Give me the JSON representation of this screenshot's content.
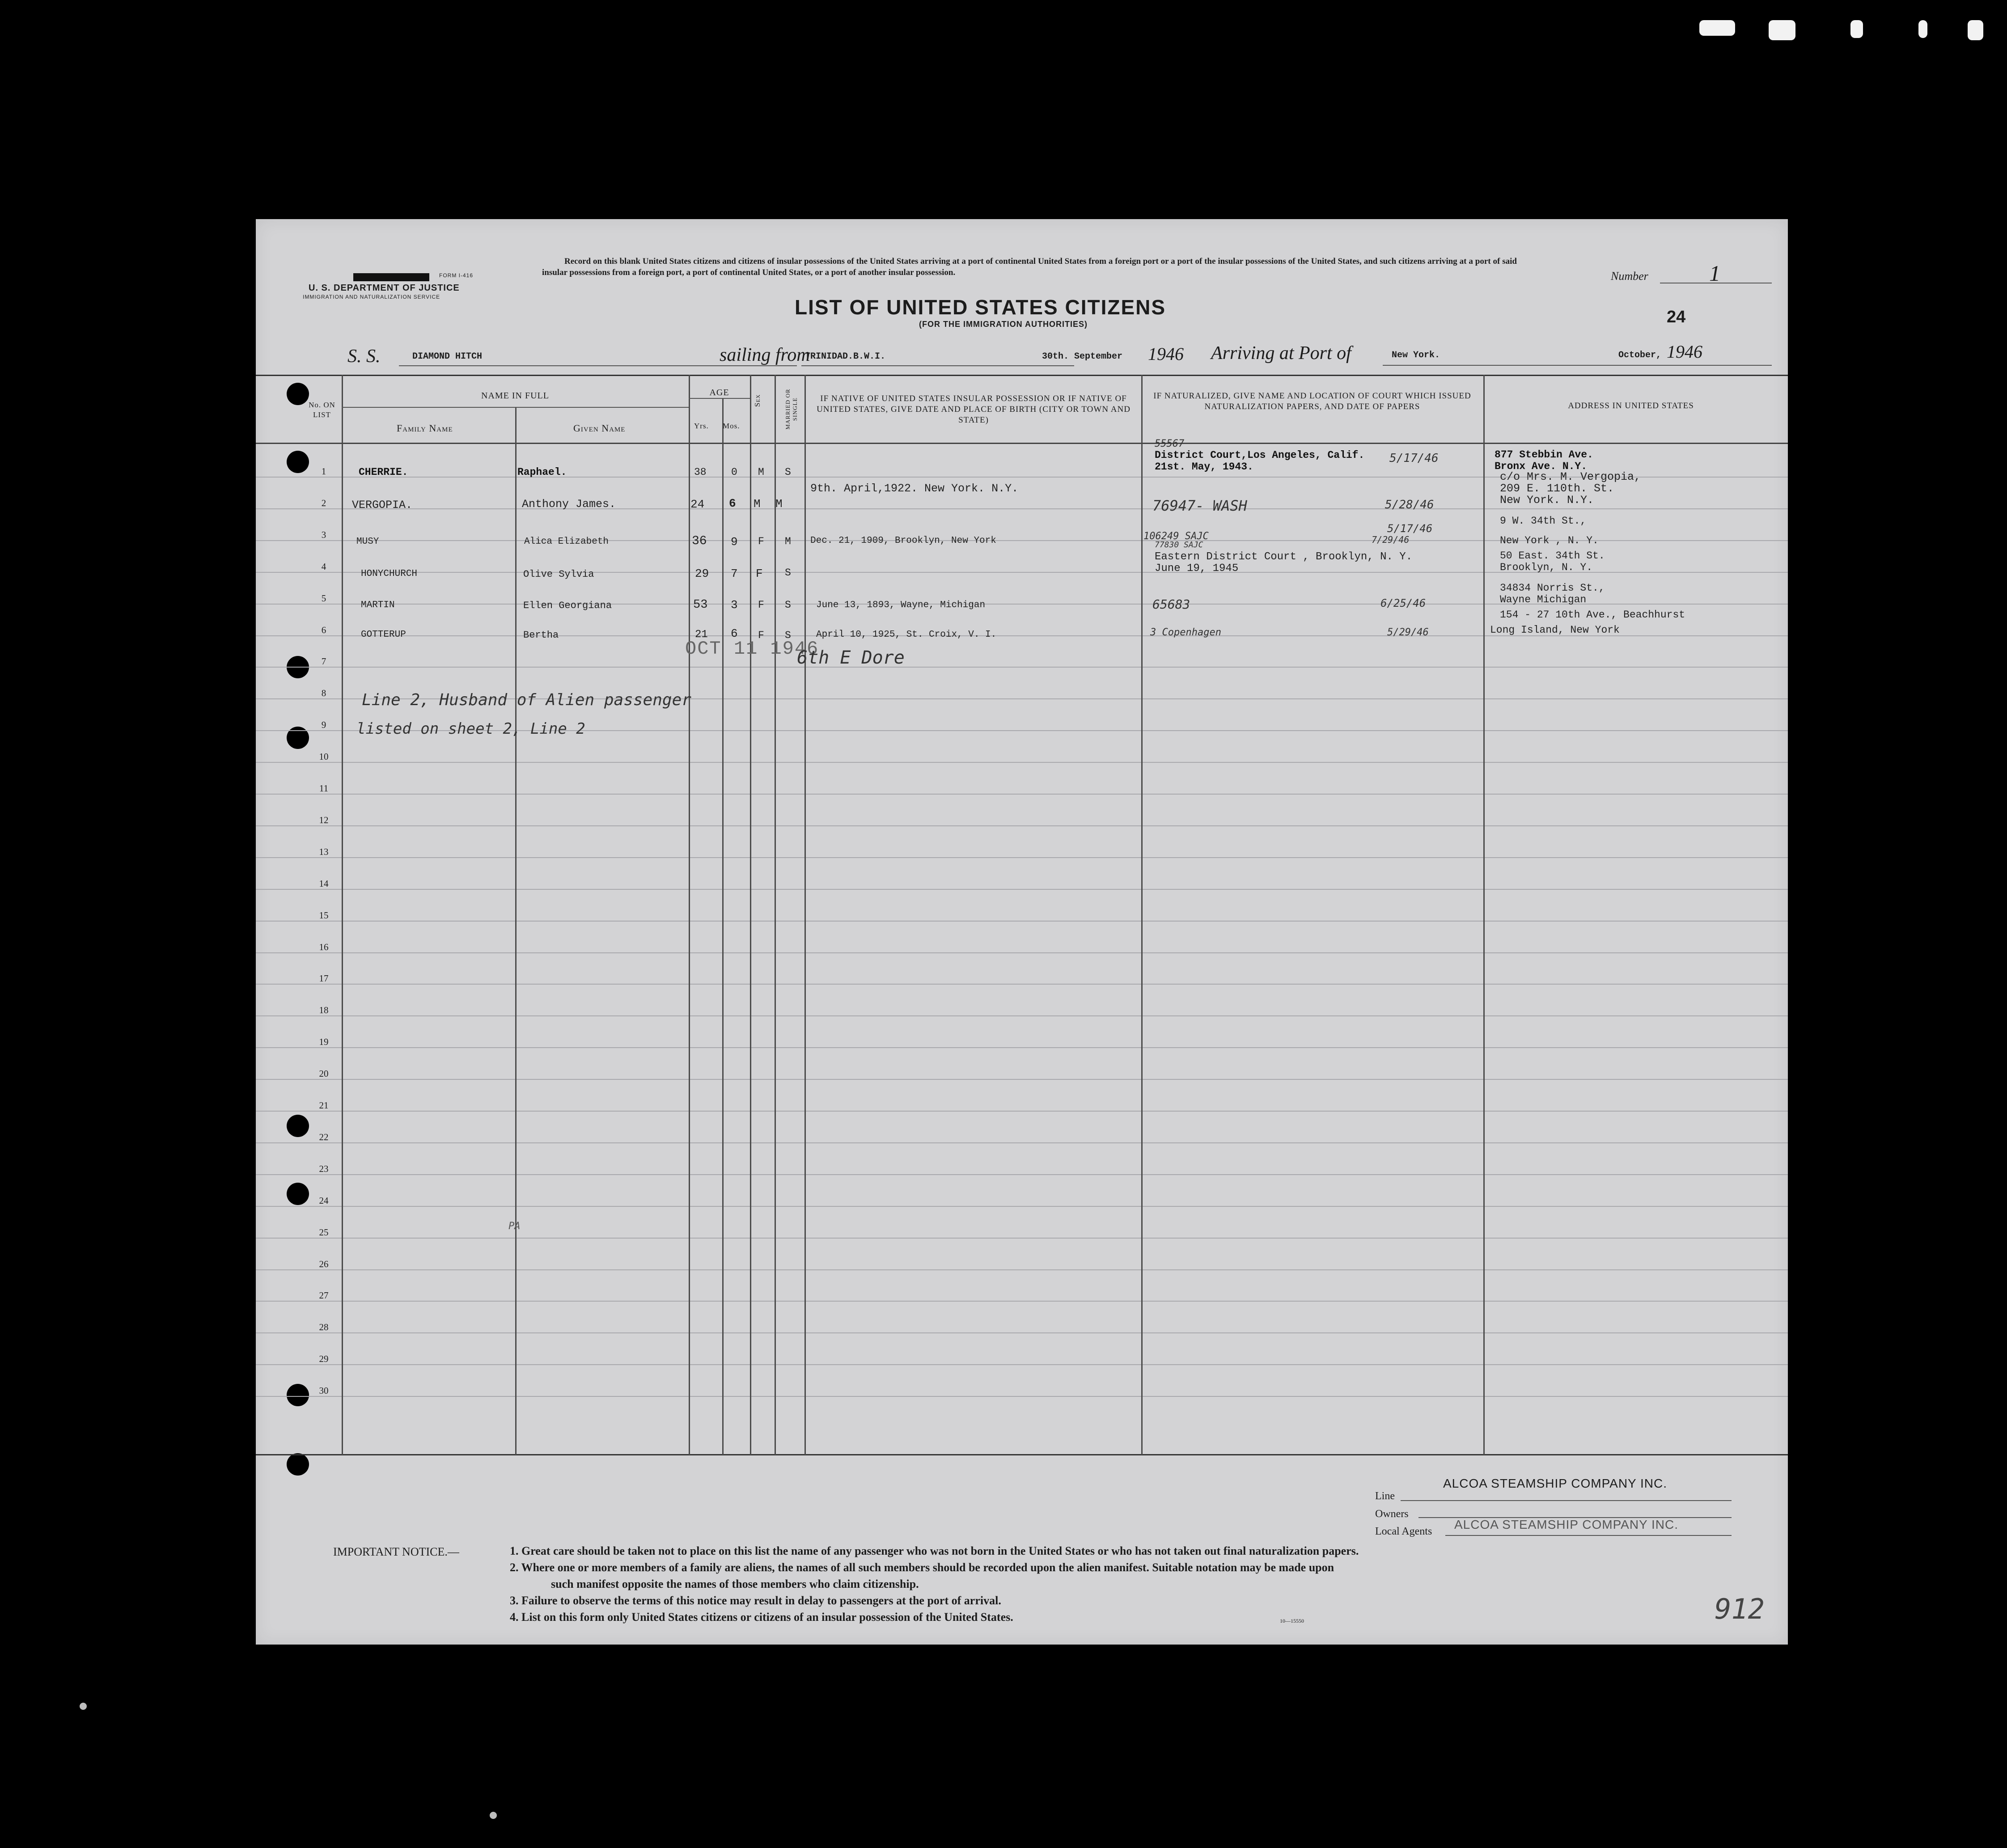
{
  "header": {
    "dept_line1": "U. S. DEPARTMENT OF JUSTICE",
    "dept_line2": "IMMIGRATION AND NATURALIZATION SERVICE",
    "form_number": "FORM I-416",
    "record_instructions": "Record on this blank United States citizens and citizens of insular possessions of the United States arriving at a port of continental United States from a foreign port or a port of the insular possessions of the United States, and such citizens arriving at a port of said insular possessions from a foreign port, a port of continental United States, or a port of another insular possession.",
    "number_label": "Number",
    "number_value": "1",
    "sheet_count": "24",
    "title": "LIST OF UNITED STATES CITIZENS",
    "subtitle": "(FOR THE IMMIGRATION AUTHORITIES)"
  },
  "voyage": {
    "ss_label": "S. S.",
    "ship": "DIAMOND HITCH",
    "sailing_label": "sailing from",
    "port_from": "TRINIDAD.B.W.I.",
    "sail_date": "30th. September",
    "sail_year": "1946",
    "arriving_label": "Arriving at Port of",
    "port_to": "New York.",
    "arrival_month": "October,",
    "arrival_year": "1946"
  },
  "columns": {
    "no_on_list": "No. ON LIST",
    "name_in_full": "NAME IN FULL",
    "family_name": "Family Name",
    "given_name": "Given Name",
    "age": "AGE",
    "yrs": "Yrs.",
    "mos": "Mos.",
    "sex": "Sex",
    "married_or_single": "MARRIED OR SINGLE",
    "birth": "IF NATIVE OF UNITED STATES INSULAR POSSESSION OR IF NATIVE OF UNITED STATES, GIVE DATE AND PLACE OF BIRTH (CITY OR TOWN AND STATE)",
    "naturalized": "IF NATURALIZED, GIVE NAME AND LOCATION OF COURT WHICH ISSUED NATURALIZATION PAPERS, AND DATE OF PAPERS",
    "address": "ADDRESS IN UNITED STATES"
  },
  "row_numbers": [
    "1",
    "2",
    "3",
    "4",
    "5",
    "6",
    "7",
    "8",
    "9",
    "10",
    "11",
    "12",
    "13",
    "14",
    "15",
    "16",
    "17",
    "18",
    "19",
    "20",
    "21",
    "22",
    "23",
    "24",
    "25",
    "26",
    "27",
    "28",
    "29",
    "30"
  ],
  "passengers": [
    {
      "no": "1",
      "family": "CHERRIE.",
      "given": "Raphael.",
      "yrs": "38",
      "mos": "0",
      "sex": "M",
      "status": "S",
      "birth": "",
      "court_line1": "District Court,Los Angeles, Calif.",
      "court_line2": "21st. May, 1943.",
      "court_note": "55567",
      "court_date": "5/17/46",
      "address_line1": "877 Stebbin Ave.",
      "address_line2": "Bronx Ave. N.Y."
    },
    {
      "no": "2",
      "family": "VERGOPIA.",
      "given": "Anthony James.",
      "yrs": "24",
      "mos": "6",
      "sex": "M",
      "status": "M",
      "birth": "9th. April,1922. New York. N.Y.",
      "court_note": "76947- WASH",
      "court_date": "5/28/46",
      "address_line1": "c/o Mrs. M. Vergopia,",
      "address_line2": "209 E. 110th. St.",
      "address_line3": "New York. N.Y."
    },
    {
      "no": "3",
      "family": "MUSY",
      "given": "Alica Elizabeth",
      "yrs": "36",
      "mos": "9",
      "sex": "F",
      "status": "M",
      "birth": "Dec. 21, 1909, Brooklyn, New York",
      "court_note": "106249 SAJC",
      "court_note2": "77830 SAJC",
      "court_date": "5/17/46",
      "court_date2": "7/29/46",
      "address_line1": "9 W. 34th St.,",
      "address_line2": "New York , N. Y."
    },
    {
      "no": "4",
      "family": "HONYCHURCH",
      "given": "Olive Sylvia",
      "yrs": "29",
      "mos": "7",
      "sex": "F",
      "status": "S",
      "birth": "",
      "court_line1": "Eastern District Court , Brooklyn, N. Y.",
      "court_line2": "June 19, 1945",
      "address_line1": "50 East. 34th St.",
      "address_line2": "Brooklyn, N. Y."
    },
    {
      "no": "5",
      "family": "MARTIN",
      "given": "Ellen Georgiana",
      "yrs": "53",
      "mos": "3",
      "sex": "F",
      "status": "S",
      "birth": "June 13, 1893, Wayne, Michigan",
      "court_note": "65683",
      "court_date": "6/25/46",
      "address_line1": "34834 Norris St.,",
      "address_line2": "Wayne Michigan"
    },
    {
      "no": "6",
      "family": "GOTTERUP",
      "given": "Bertha",
      "yrs": "21",
      "mos": "6",
      "sex": "F",
      "status": "S",
      "birth": "April 10, 1925, St. Croix, V. I.",
      "court_note": "3 Copenhagen",
      "court_date": "5/29/46",
      "address_line1": "154 - 27 10th Ave., Beachhurst",
      "address_line2": "Long Island, New York"
    }
  ],
  "stamp_date": "OCT 11 1946",
  "handwritten": {
    "row6_note": "6th E Dore",
    "line8": "Line 2, Husband of Alien passenger",
    "line9": "listed on sheet 2, Line 2",
    "mark_row25": "PA",
    "page_number": "912"
  },
  "footer": {
    "line_label": "Line",
    "line_value": "ALCOA STEAMSHIP COMPANY INC.",
    "owners_label": "Owners",
    "agents_label": "Local Agents",
    "agents_value": "ALCOA STEAMSHIP COMPANY INC.",
    "notice_title": "IMPORTANT NOTICE.—",
    "notice_1": "1. Great care should be taken not to place on this list the name of any passenger who was not born in the United States or who has not taken out final naturalization papers.",
    "notice_2a": "2. Where one or more members of a family are aliens, the names of all such members should be recorded upon the alien manifest.  Suitable notation may be made upon",
    "notice_2b": "such manifest opposite the names of those members who claim citizenship.",
    "notice_3": "3. Failure to observe the terms of this notice may result in delay to passengers at the port of arrival.",
    "notice_4": "4. List on this form only United States citizens or citizens of an insular possession of the United States.",
    "print_code": "10—15550"
  }
}
